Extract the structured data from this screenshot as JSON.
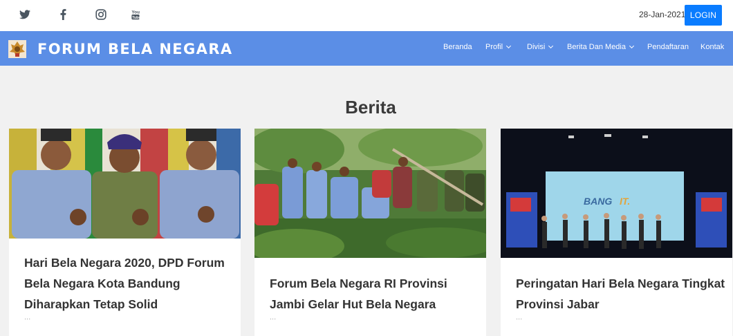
{
  "topbar": {
    "social": [
      {
        "icon": "twitter-icon"
      },
      {
        "icon": "facebook-icon"
      },
      {
        "icon": "instagram-icon"
      },
      {
        "icon": "youtube-icon"
      }
    ],
    "date": "28-Jan-2021",
    "login_label": "LOGIN"
  },
  "navbar": {
    "brand": "FORUM BELA NEGARA",
    "items": [
      {
        "label": "Beranda"
      },
      {
        "label": "Profil"
      },
      {
        "label": "Divisi"
      },
      {
        "label": "Berita Dan Media"
      },
      {
        "label": "Pendaftaran"
      },
      {
        "label": "Kontak"
      }
    ]
  },
  "main": {
    "section_title": "Berita",
    "cards": [
      {
        "title": "Hari Bela Negara 2020, DPD Forum Bela Negara Kota Bandung Diharapkan Tetap Solid",
        "excerpt": "..."
      },
      {
        "title": "Forum Bela Negara RI Provinsi Jambi Gelar Hut Bela Negara",
        "excerpt": "..."
      },
      {
        "title": "Peringatan Hari Bela Negara Tingkat Provinsi Jabar",
        "excerpt": "..."
      }
    ]
  },
  "colors": {
    "navbar": "#5b8ee6",
    "login": "#0a7cff",
    "background": "#f1f1f1"
  }
}
